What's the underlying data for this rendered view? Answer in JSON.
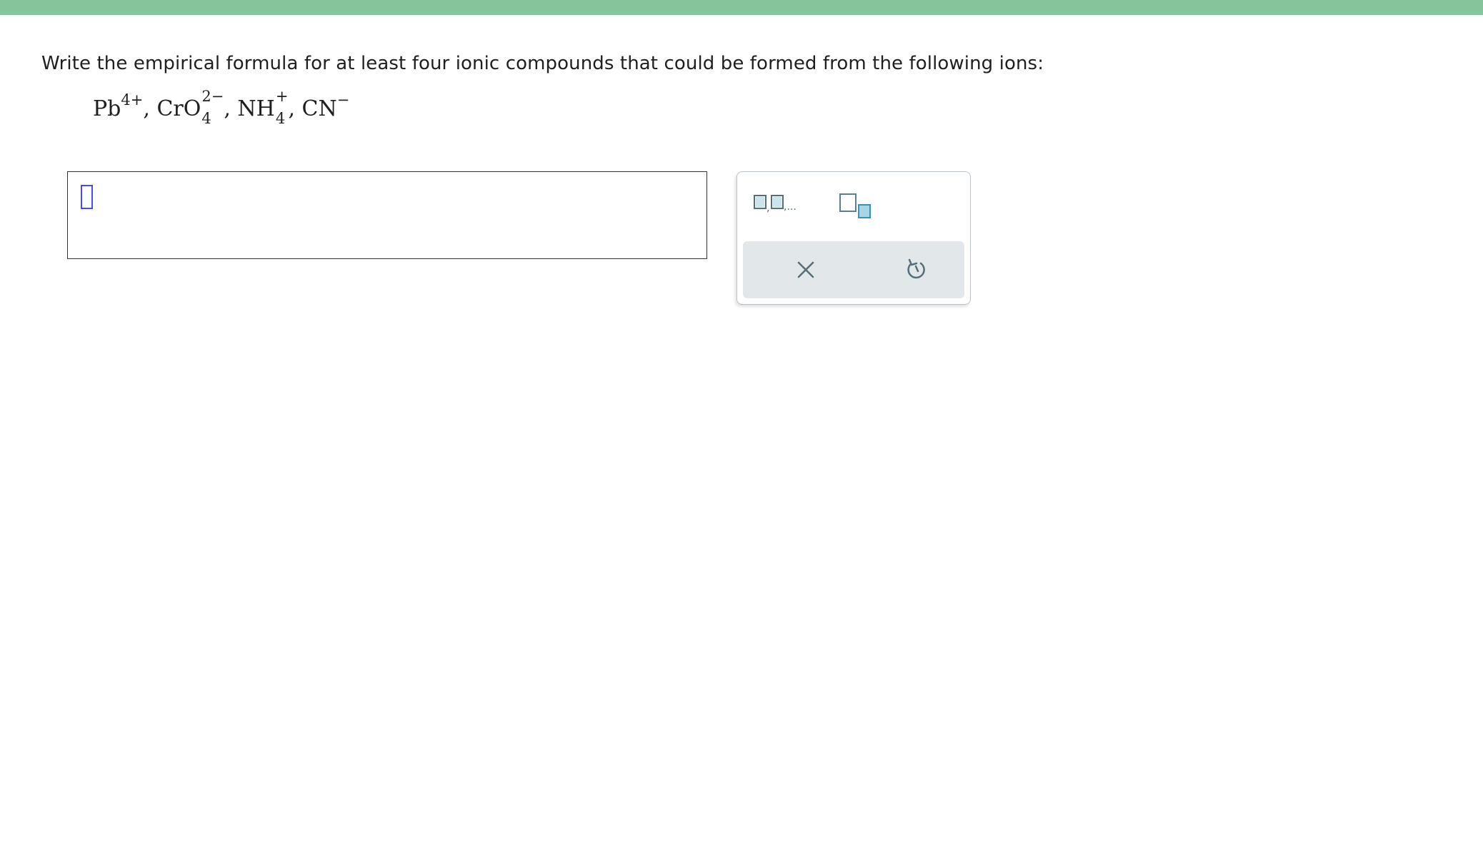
{
  "header": {
    "bar_color": "#86c59c"
  },
  "question": {
    "prompt": "Write the empirical formula for at least four ionic compounds that could be formed from the following ions:",
    "ions": [
      {
        "symbol": "Pb",
        "subscript": "",
        "charge": "4+"
      },
      {
        "symbol": "CrO",
        "subscript": "4",
        "charge": "2−"
      },
      {
        "symbol": "NH",
        "subscript": "4",
        "charge": "+"
      },
      {
        "symbol": "CN",
        "subscript": "",
        "charge": "−"
      }
    ],
    "separator": ","
  },
  "answer": {
    "value": ""
  },
  "toolbar": {
    "list_tool_icon": "comma-list-icon",
    "subscript_tool_icon": "subscript-icon",
    "clear_icon": "x-icon",
    "undo_icon": "undo-icon",
    "accent_color": "#3f8fb0",
    "icon_color": "#546e7a"
  }
}
